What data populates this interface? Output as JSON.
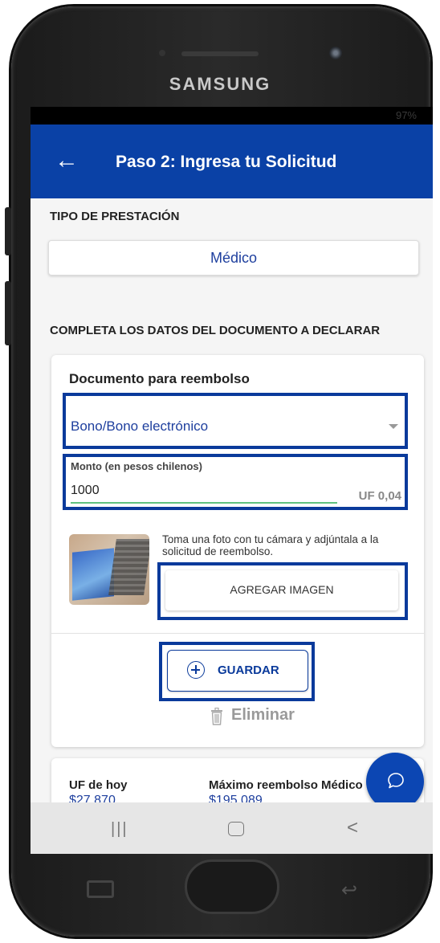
{
  "device": {
    "brand": "SAMSUNG",
    "battery": "97%"
  },
  "header": {
    "back_icon": "←",
    "title": "Paso 2: Ingresa tu Solicitud"
  },
  "tipo": {
    "label": "TIPO DE PRESTACIÓN",
    "value": "Médico"
  },
  "section": {
    "label": "COMPLETA LOS DATOS DEL DOCUMENTO A DECLARAR"
  },
  "document": {
    "title": "Documento para reembolso",
    "select_value": "Bono/Bono electrónico",
    "amount_label": "Monto (en pesos chilenos)",
    "amount_value": "1000",
    "amount_uf": "UF 0,04",
    "photo_text": "Toma una foto con tu cámara y adjúntala a la solicitud de reembolso.",
    "add_image_label": "AGREGAR IMAGEN",
    "save_label": "GUARDAR",
    "delete_label": "Eliminar"
  },
  "summary": {
    "uf_label": "UF de hoy",
    "uf_value": "$27.870",
    "max_label": "Máximo reembolso Médico",
    "max_value": "$195.089"
  },
  "navbar": {
    "recent": "|||",
    "back": "<"
  },
  "colors": {
    "primary": "#0a41a6",
    "highlight_border": "#0a3a9b",
    "link_blue": "#1e3f9e",
    "input_underline": "#61c27f"
  }
}
